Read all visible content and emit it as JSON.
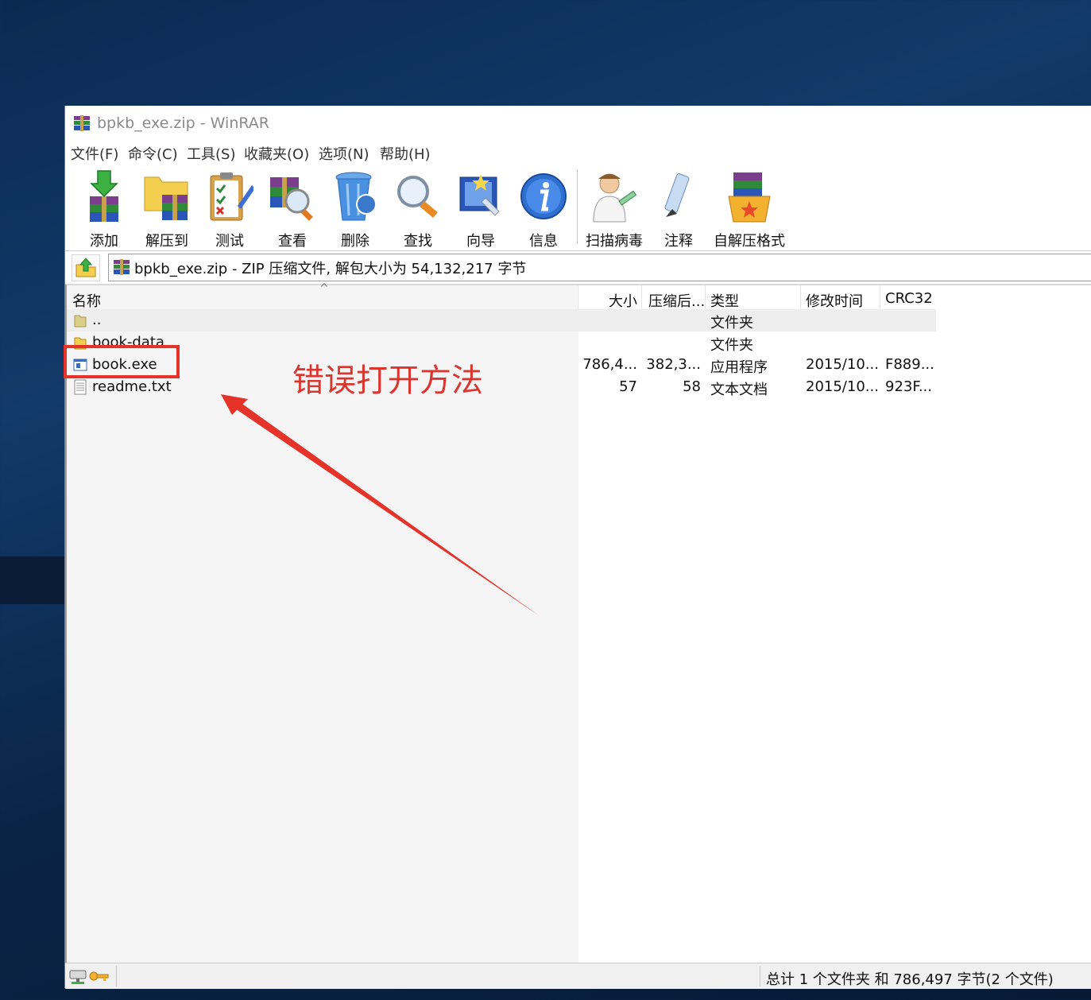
{
  "window": {
    "title": "bpkb_exe.zip - WinRAR"
  },
  "menu": [
    "文件(F)",
    "命令(C)",
    "工具(S)",
    "收藏夹(O)",
    "选项(N)",
    "帮助(H)"
  ],
  "toolbar": {
    "add": "添加",
    "extract_to": "解压到",
    "test": "测试",
    "view": "查看",
    "delete": "删除",
    "find": "查找",
    "wizard": "向导",
    "info": "信息",
    "virus_scan": "扫描病毒",
    "comment": "注释",
    "sfx": "自解压格式"
  },
  "address": {
    "path": "bpkb_exe.zip - ZIP 压缩文件, 解包大小为 54,132,217 字节"
  },
  "columns": {
    "name": "名称",
    "size": "大小",
    "packed": "压缩后...",
    "type": "类型",
    "modified": "修改时间",
    "crc": "CRC32",
    "sort_indicator": "^"
  },
  "files": [
    {
      "name": "..",
      "size": "",
      "packed": "",
      "type": "文件夹",
      "modified": "",
      "crc": ""
    },
    {
      "name": "book-data",
      "size": "",
      "packed": "",
      "type": "文件夹",
      "modified": "",
      "crc": ""
    },
    {
      "name": "book.exe",
      "size": "786,4...",
      "packed": "382,3...",
      "type": "应用程序",
      "modified": "2015/10...",
      "crc": "F889..."
    },
    {
      "name": "readme.txt",
      "size": "57",
      "packed": "58",
      "type": "文本文档",
      "modified": "2015/10...",
      "crc": "923F..."
    }
  ],
  "annotation": {
    "text": "错误打开方法",
    "color": "#d9362f"
  },
  "status": {
    "summary": "总计 1 个文件夹 和 786,497 字节(2 个文件)"
  }
}
